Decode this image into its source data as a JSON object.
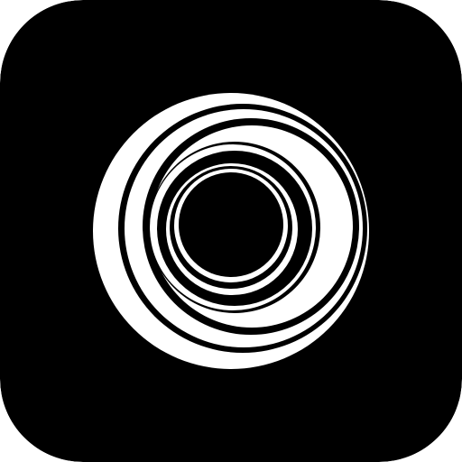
{
  "app_icon": {
    "icon": "concentric-rings-icon",
    "background_color": "#000000",
    "foreground_color": "#ffffff"
  }
}
